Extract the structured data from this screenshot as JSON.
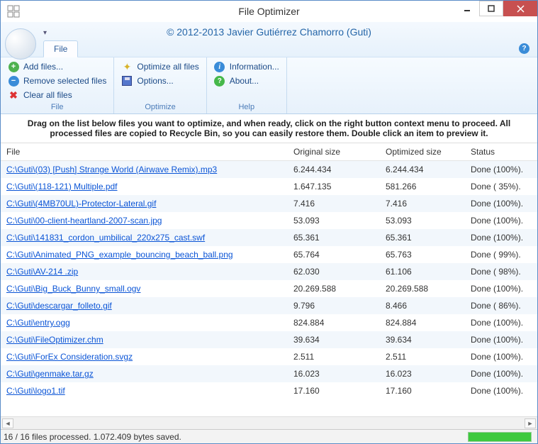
{
  "title": "File Optimizer",
  "copyright": "© 2012-2013 Javier Gutiérrez Chamorro (Guti)",
  "tabs": {
    "file": "File"
  },
  "toolbar": {
    "file_group_label": "File",
    "optimize_group_label": "Optimize",
    "help_group_label": "Help",
    "add_files": "Add files...",
    "remove_selected": "Remove selected files",
    "clear_all": "Clear all files",
    "optimize_all": "Optimize all files",
    "options": "Options...",
    "information": "Information...",
    "about": "About..."
  },
  "instruction": "Drag on the list below files you want to optimize, and when ready, click on the right button context menu to proceed. All processed files are copied to Recycle Bin, so you can easily restore them. Double click an item to preview it.",
  "columns": {
    "file": "File",
    "original": "Original size",
    "optimized": "Optimized size",
    "status": "Status"
  },
  "rows": [
    {
      "file": "C:\\Guti\\(03) [Push] Strange World (Airwave Remix).mp3",
      "original": "6.244.434",
      "optimized": "6.244.434",
      "status": "Done (100%)."
    },
    {
      "file": "C:\\Guti\\(118-121) Multiple.pdf",
      "original": "1.647.135",
      "optimized": "581.266",
      "status": "Done ( 35%)."
    },
    {
      "file": "C:\\Guti\\(4MB70UL)-Protector-Lateral.gif",
      "original": "7.416",
      "optimized": "7.416",
      "status": "Done (100%)."
    },
    {
      "file": "C:\\Guti\\00-client-heartland-2007-scan.jpg",
      "original": "53.093",
      "optimized": "53.093",
      "status": "Done (100%)."
    },
    {
      "file": "C:\\Guti\\141831_cordon_umbilical_220x275_cast.swf",
      "original": "65.361",
      "optimized": "65.361",
      "status": "Done (100%)."
    },
    {
      "file": "C:\\Guti\\Animated_PNG_example_bouncing_beach_ball.png",
      "original": "65.764",
      "optimized": "65.763",
      "status": "Done ( 99%)."
    },
    {
      "file": "C:\\Guti\\AV-214 .zip",
      "original": "62.030",
      "optimized": "61.106",
      "status": "Done ( 98%)."
    },
    {
      "file": "C:\\Guti\\Big_Buck_Bunny_small.ogv",
      "original": "20.269.588",
      "optimized": "20.269.588",
      "status": "Done (100%)."
    },
    {
      "file": "C:\\Guti\\descargar_folleto.gif",
      "original": "9.796",
      "optimized": "8.466",
      "status": "Done ( 86%)."
    },
    {
      "file": "C:\\Guti\\entry.ogg",
      "original": "824.884",
      "optimized": "824.884",
      "status": "Done (100%)."
    },
    {
      "file": "C:\\Guti\\FileOptimizer.chm",
      "original": "39.634",
      "optimized": "39.634",
      "status": "Done (100%)."
    },
    {
      "file": "C:\\Guti\\ForEx Consideration.svgz",
      "original": "2.511",
      "optimized": "2.511",
      "status": "Done (100%)."
    },
    {
      "file": "C:\\Guti\\genmake.tar.gz",
      "original": "16.023",
      "optimized": "16.023",
      "status": "Done (100%)."
    },
    {
      "file": "C:\\Guti\\logo1.tif",
      "original": "17.160",
      "optimized": "17.160",
      "status": "Done (100%)."
    }
  ],
  "statusbar": "16 / 16 files processed. 1.072.409 bytes saved."
}
